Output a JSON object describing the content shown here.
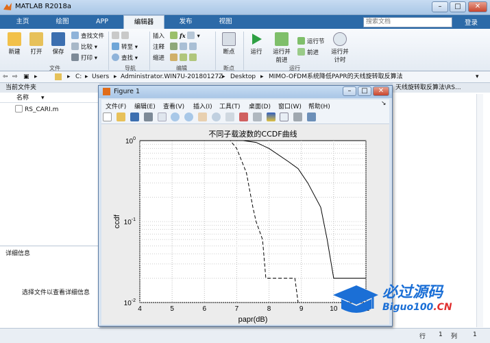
{
  "app": {
    "title": "MATLAB R2018a"
  },
  "tabs": [
    {
      "label": "主页"
    },
    {
      "label": "绘图"
    },
    {
      "label": "APP"
    },
    {
      "label": "编辑器"
    },
    {
      "label": "发布"
    },
    {
      "label": "视图"
    }
  ],
  "search": {
    "placeholder": "搜索文档"
  },
  "login": "登录",
  "ribbon": {
    "file": {
      "new": "新建",
      "open": "打开",
      "save": "保存",
      "find_files": "查找文件",
      "compare": "比较",
      "print": "打印",
      "group": "文件"
    },
    "nav": {
      "goto": "转至",
      "find": "查找",
      "group": "导航"
    },
    "edit": {
      "insert": "插入",
      "comment": "注释",
      "indent": "缩进",
      "fx": "fx",
      "group": "编辑"
    },
    "breakpoint": {
      "label": "断点",
      "group": "断点"
    },
    "run": {
      "run": "运行",
      "run_advance": "运行并前进",
      "run_section": "运行节",
      "advance": "前进",
      "run_time": "运行并计时",
      "group": "运行"
    }
  },
  "address": {
    "parts": [
      "C:",
      "Users",
      "Administrator.WIN7U-20180127Z",
      "Desktop",
      "MIMO-OFDM系统降低PAPR的天线旋转取反算法"
    ]
  },
  "current_folder": {
    "title": "当前文件夹",
    "col_name": "名称",
    "files": [
      "RS_CARI.m"
    ]
  },
  "details": {
    "title": "详细信息",
    "hint": "选择文件以查看详细信息"
  },
  "right_panel": {
    "path_tail": "天线旋转取反算法\\RS..."
  },
  "statusbar": {
    "row_label": "行",
    "row": "1",
    "col_label": "列",
    "col": "1"
  },
  "figure": {
    "title": "Figure 1",
    "menu": [
      "文件(F)",
      "编辑(E)",
      "查看(V)",
      "插入(I)",
      "工具(T)",
      "桌面(D)",
      "窗口(W)",
      "帮助(H)"
    ]
  },
  "watermark": {
    "cn": "必过源码",
    "en_prefix": "Biguo100",
    "en_suffix": ".CN"
  },
  "colors": {
    "tabbar": "#2c6aa8",
    "run": "#2ea043",
    "accent": "#f0a020"
  },
  "chart_data": {
    "type": "line",
    "title": "不同子载波数的CCDF曲线",
    "xlabel": "papr(dB)",
    "ylabel": "ccdf",
    "xlim": [
      4,
      11
    ],
    "ylim": [
      0.01,
      1
    ],
    "yscale": "log",
    "xticks": [
      "4",
      "5",
      "6",
      "7",
      "8",
      "9",
      "10",
      "11"
    ],
    "yticks": [
      "10^-2",
      "10^-1",
      "10^0"
    ],
    "grid": true,
    "series": [
      {
        "style": "solid",
        "x": [
          4,
          7.2,
          7.6,
          8,
          8.6,
          8.9,
          9.2,
          9.6,
          9.8,
          10,
          10.5,
          11
        ],
        "y": [
          1,
          1,
          0.95,
          0.8,
          0.55,
          0.45,
          0.3,
          0.15,
          0.06,
          0.02,
          0.02,
          0.02
        ]
      },
      {
        "style": "dashed",
        "x": [
          4,
          6.8,
          7.0,
          7.3,
          7.5,
          7.6,
          7.8,
          7.9,
          8.2,
          8.5,
          8.8,
          8.9
        ],
        "y": [
          1,
          1,
          0.8,
          0.4,
          0.15,
          0.1,
          0.06,
          0.02,
          0.02,
          0.02,
          0.02,
          0.01
        ]
      }
    ]
  }
}
